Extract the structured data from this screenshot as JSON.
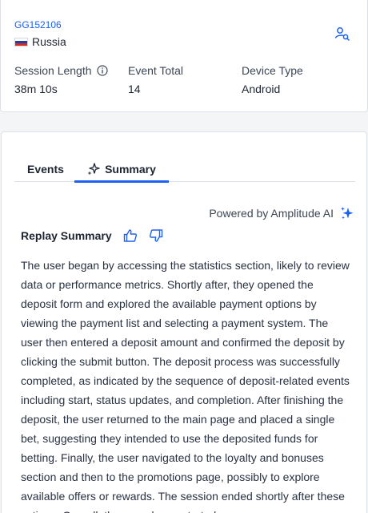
{
  "user": {
    "id": "GG152106",
    "country": "Russia",
    "flag_colors": [
      "#ffffff",
      "#1c3fae",
      "#d52b1e"
    ]
  },
  "stats": [
    {
      "label": "Session Length",
      "value": "38m 10s",
      "has_info_icon": true
    },
    {
      "label": "Event Total",
      "value": "14"
    },
    {
      "label": "Device Type",
      "value": "Android"
    }
  ],
  "tabs": {
    "events_label": "Events",
    "summary_label": "Summary",
    "active": "Summary"
  },
  "ai": {
    "powered_by": "Powered by Amplitude AI"
  },
  "summary": {
    "title": "Replay Summary",
    "text": "The user began by accessing the statistics section, likely to review data or performance metrics. Shortly after, they opened the deposit form and explored the available payment options by viewing the payment list and selecting a payment system. The user then entered a deposit amount and confirmed the deposit by clicking the submit button. The deposit process was successfully completed, as indicated by the sequence of deposit-related events including start, status updates, and completion. After finishing the deposit, the user returned to the main page and placed a single bet, suggesting they intended to use the deposited funds for betting. Finally, the user navigated to the loyalty and bonuses section and then to the promotions page, possibly to explore available offers or rewards. The session ended shortly after these actions. Overall, the user demonstrated"
  },
  "colors": {
    "accent": "#1e61f0",
    "text": "#1e2532",
    "border": "#dde1e7"
  },
  "icons": [
    "user-search-icon",
    "info-icon",
    "sparkle-icon",
    "thumbs-up-icon",
    "thumbs-down-icon"
  ]
}
